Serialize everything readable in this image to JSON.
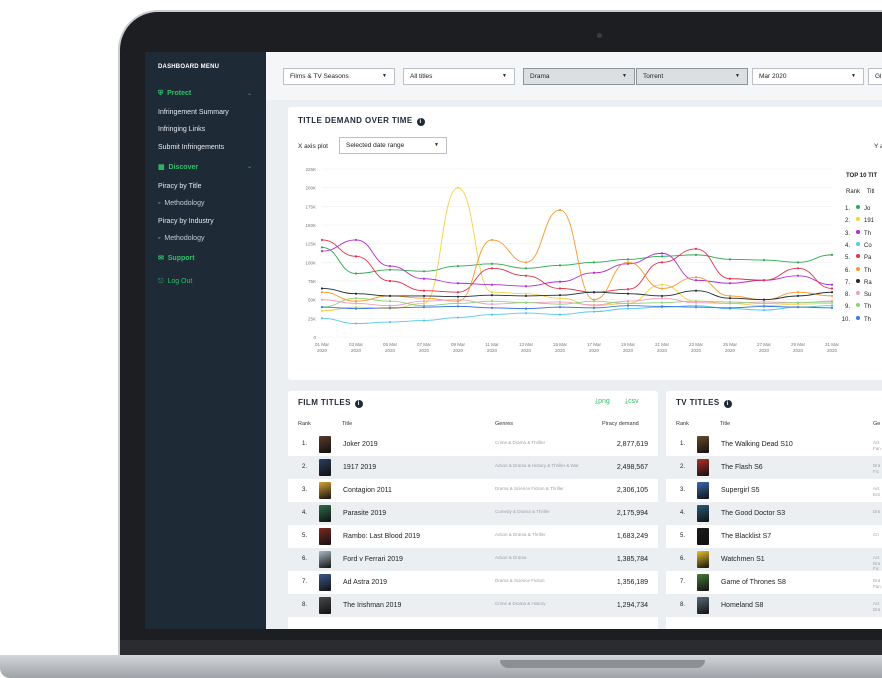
{
  "sidebar": {
    "title": "DASHBOARD MENU",
    "protect": "Protect",
    "infringement_summary": "Infringement Summary",
    "infringing_links": "Infringing Links",
    "submit_infringements": "Submit Infringements",
    "discover": "Discover",
    "piracy_by_title": "Piracy by Title",
    "methodology_1": "Methodology",
    "piracy_by_industry": "Piracy by Industry",
    "methodology_2": "Methodology",
    "support": "Support",
    "logout": "Log Out"
  },
  "filters": {
    "content_type": "Films & TV Seasons",
    "titles": "All titles",
    "genre": "Drama",
    "source": "Torrent",
    "period": "Mar 2020",
    "region": "Gl"
  },
  "demand_chart": {
    "title": "TITLE DEMAND OVER TIME",
    "x_axis_label": "X axis plot",
    "x_axis_value": "Selected date range",
    "y_axis_label": "Y a",
    "legend_title": "TOP 10 TIT",
    "legend_rank_header": "Rank",
    "legend_title_header": "Titl",
    "legend_items": [
      {
        "rank": "1.",
        "title": "Jo",
        "color": "#2fa84f"
      },
      {
        "rank": "2.",
        "title": "191",
        "color": "#f3d046"
      },
      {
        "rank": "3.",
        "title": "Th",
        "color": "#b02fc7"
      },
      {
        "rank": "4.",
        "title": "Co",
        "color": "#58c8e8"
      },
      {
        "rank": "5.",
        "title": "Pa",
        "color": "#e0314b"
      },
      {
        "rank": "6.",
        "title": "Th",
        "color": "#f59a2e"
      },
      {
        "rank": "7.",
        "title": "Ra",
        "color": "#1e2a36"
      },
      {
        "rank": "8.",
        "title": "Su",
        "color": "#f29bbd"
      },
      {
        "rank": "9.",
        "title": "Th",
        "color": "#8ed17a"
      },
      {
        "rank": "10.",
        "title": "Th",
        "color": "#3f7be0"
      }
    ]
  },
  "chart_data": {
    "type": "line",
    "title": "TITLE DEMAND OVER TIME",
    "xlabel": "",
    "ylabel": "",
    "ylim": [
      0,
      225000
    ],
    "y_ticks": [
      "0",
      "25K",
      "50K",
      "75K",
      "100K",
      "125K",
      "150K",
      "175K",
      "200K",
      "225K"
    ],
    "x_ticks": [
      [
        "01 Mar",
        "2020"
      ],
      [
        "03 Mar",
        "2020"
      ],
      [
        "05 Mar",
        "2020"
      ],
      [
        "07 Mar",
        "2020"
      ],
      [
        "09 Mar",
        "2020"
      ],
      [
        "11 Mar",
        "2020"
      ],
      [
        "13 Mar",
        "2020"
      ],
      [
        "15 Mar",
        "2020"
      ],
      [
        "17 Mar",
        "2020"
      ],
      [
        "19 Mar",
        "2020"
      ],
      [
        "21 Mar",
        "2020"
      ],
      [
        "23 Mar",
        "2020"
      ],
      [
        "25 Mar",
        "2020"
      ],
      [
        "27 Mar",
        "2020"
      ],
      [
        "29 Mar",
        "2020"
      ],
      [
        "31 Mar",
        "2020"
      ]
    ],
    "x": [
      1,
      3,
      5,
      7,
      9,
      11,
      13,
      15,
      17,
      19,
      21,
      23,
      25,
      27,
      29,
      31
    ],
    "series": [
      {
        "color": "#2fa84f",
        "values": [
          120000,
          85000,
          90000,
          88000,
          95000,
          98000,
          92000,
          96000,
          100000,
          104000,
          108000,
          110000,
          104000,
          103000,
          100000,
          110000
        ]
      },
      {
        "color": "#f3d046",
        "values": [
          35000,
          40000,
          38000,
          45000,
          200000,
          60000,
          58000,
          52000,
          42000,
          45000,
          70000,
          48000,
          45000,
          42000,
          44000,
          45000
        ]
      },
      {
        "color": "#b02fc7",
        "values": [
          115000,
          130000,
          95000,
          78000,
          72000,
          70000,
          68000,
          74000,
          86000,
          98000,
          112000,
          76000,
          72000,
          76000,
          82000,
          70000
        ]
      },
      {
        "color": "#58c8e8",
        "values": [
          25000,
          18000,
          20000,
          22000,
          26000,
          30000,
          32000,
          30000,
          34000,
          38000,
          40000,
          42000,
          38000,
          36000,
          40000,
          42000
        ]
      },
      {
        "color": "#e0314b",
        "values": [
          130000,
          108000,
          75000,
          62000,
          60000,
          92000,
          82000,
          65000,
          60000,
          64000,
          100000,
          118000,
          78000,
          76000,
          92000,
          65000
        ]
      },
      {
        "color": "#f59a2e",
        "values": [
          60000,
          48000,
          55000,
          52000,
          48000,
          130000,
          100000,
          170000,
          50000,
          100000,
          65000,
          80000,
          55000,
          50000,
          60000,
          55000
        ]
      },
      {
        "color": "#1e2a36",
        "values": [
          65000,
          58000,
          55000,
          55000,
          54000,
          56000,
          55000,
          56000,
          60000,
          58000,
          55000,
          62000,
          52000,
          50000,
          55000,
          60000
        ]
      },
      {
        "color": "#f29bbd",
        "values": [
          50000,
          45000,
          42000,
          48000,
          50000,
          44000,
          46000,
          47000,
          43000,
          48000,
          52000,
          46000,
          45000,
          47000,
          46000,
          48000
        ]
      },
      {
        "color": "#8ed17a",
        "values": [
          40000,
          52000,
          48000,
          42000,
          45000,
          48000,
          46000,
          44000,
          48000,
          45000,
          46000,
          48000,
          47000,
          45000,
          46000,
          47000
        ]
      },
      {
        "color": "#3f7be0",
        "values": [
          40000,
          38000,
          39000,
          40000,
          41000,
          39000,
          38000,
          40000,
          39000,
          42000,
          41000,
          40000,
          39000,
          41000,
          40000,
          39000
        ]
      }
    ]
  },
  "film_table": {
    "title": "FILM TITLES",
    "png": "png",
    "csv": "csv",
    "headers": [
      "Rank",
      "Title",
      "Genres",
      "Piracy demand"
    ],
    "rows": [
      {
        "rank": "1.",
        "title": "Joker 2019",
        "genres": "Crime & Drama & Thriller",
        "demand": "2,877,619",
        "poster": "#5a3a2a"
      },
      {
        "rank": "2.",
        "title": "1917 2019",
        "genres": "Action & Drama & History & Thriller & War",
        "demand": "2,498,567",
        "poster": "#2a3d5a"
      },
      {
        "rank": "3.",
        "title": "Contagion 2011",
        "genres": "Drama & Science Fiction & Thriller",
        "demand": "2,306,105",
        "poster": "#d8a23a"
      },
      {
        "rank": "4.",
        "title": "Parasite 2019",
        "genres": "Comedy & Drama & Thriller",
        "demand": "2,175,994",
        "poster": "#2f6b4a"
      },
      {
        "rank": "5.",
        "title": "Rambo: Last Blood 2019",
        "genres": "Action & Drama & Thriller",
        "demand": "1,683,249",
        "poster": "#7a2a22"
      },
      {
        "rank": "6.",
        "title": "Ford v Ferrari 2019",
        "genres": "Action & Drama",
        "demand": "1,385,784",
        "poster": "#a9b8c6"
      },
      {
        "rank": "7.",
        "title": "Ad Astra 2019",
        "genres": "Drama & Science Fiction",
        "demand": "1,356,189",
        "poster": "#3c5a8a"
      },
      {
        "rank": "8.",
        "title": "The Irishman 2019",
        "genres": "Crime & Drama & History",
        "demand": "1,294,734",
        "poster": "#4a4a4a"
      }
    ]
  },
  "tv_table": {
    "title": "TV TITLES",
    "headers": [
      "Rank",
      "Title",
      "Ge"
    ],
    "rows": [
      {
        "rank": "1.",
        "title": "The Walking Dead S10",
        "genres": "Act Fan",
        "poster": "#6b4a2a"
      },
      {
        "rank": "2.",
        "title": "The Flash S6",
        "genres": "Dra Fic",
        "poster": "#b0302a"
      },
      {
        "rank": "3.",
        "title": "Supergirl S5",
        "genres": "Act Ent",
        "poster": "#3a6ab0"
      },
      {
        "rank": "4.",
        "title": "The Good Doctor S3",
        "genres": "Dra",
        "poster": "#2a5a7a"
      },
      {
        "rank": "5.",
        "title": "The Blacklist S7",
        "genres": "Cri",
        "poster": "#1a1a1a"
      },
      {
        "rank": "6.",
        "title": "Watchmen S1",
        "genres": "Act Dra Fic",
        "poster": "#e8c22a"
      },
      {
        "rank": "7.",
        "title": "Game of Thrones S8",
        "genres": "Dra Fan",
        "poster": "#4a7a3a"
      },
      {
        "rank": "8.",
        "title": "Homeland S8",
        "genres": "Act Dra",
        "poster": "#5a6a7a"
      }
    ]
  }
}
